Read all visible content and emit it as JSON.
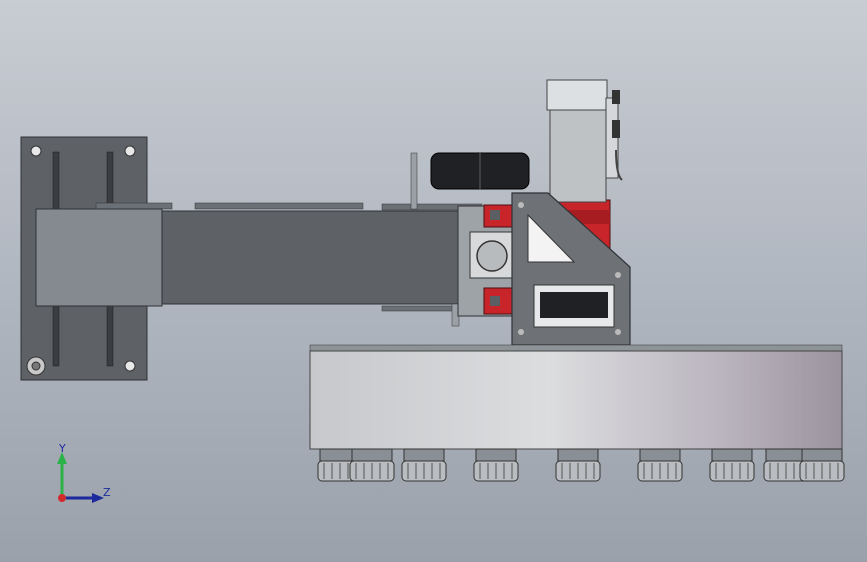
{
  "viewport": {
    "background_top": "#c8ccd3",
    "background_bottom": "#9aa1ab"
  },
  "colors": {
    "steel_dark": "#5a5e63",
    "steel_mid": "#7c8187",
    "steel_light": "#a9adb2",
    "red_part": "#c8252a",
    "turntable": "#d6d7d9",
    "motor_body": "#bfc2c5"
  },
  "triad": {
    "y_label": "Y",
    "z_label": "Z",
    "y_color": "#2bb34a",
    "z_color": "#1c2a9c",
    "x_color": "#d22b2b"
  }
}
